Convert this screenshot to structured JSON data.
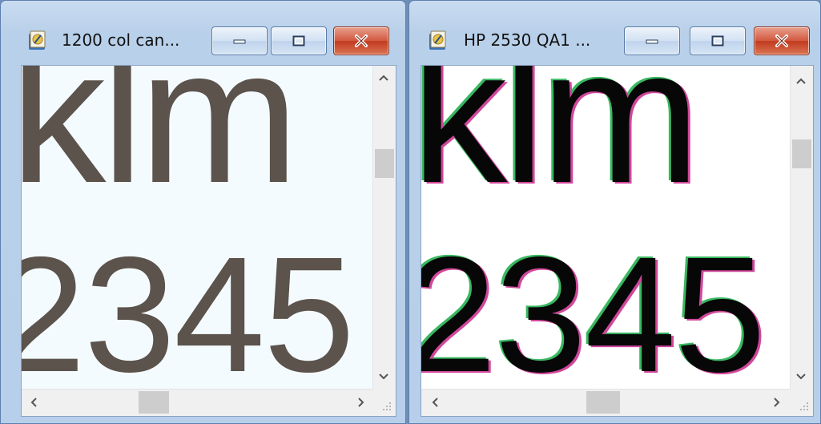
{
  "windows": [
    {
      "title": "1200 col can...",
      "content": {
        "line1": "jklm",
        "line2": "2345"
      }
    },
    {
      "title": "HP 2530 QA1 ...",
      "content": {
        "line1": "jklm",
        "line2": "2345"
      }
    }
  ],
  "colors": {
    "desktop": "#6f8fb8",
    "titlebar": "#b9d0ea",
    "close_button": "#c23a1f",
    "w1_text": "#5b534c",
    "w2_text": "#070707",
    "w2_fringe_magenta": "#d0479b",
    "w2_fringe_green": "#39b861"
  },
  "icons": {
    "app": "paint-document-icon",
    "minimize": "minimize-icon",
    "maximize": "maximize-icon",
    "close": "close-icon",
    "scroll_up": "chevron-up-icon",
    "scroll_down": "chevron-down-icon",
    "scroll_left": "chevron-left-icon",
    "scroll_right": "chevron-right-icon"
  }
}
